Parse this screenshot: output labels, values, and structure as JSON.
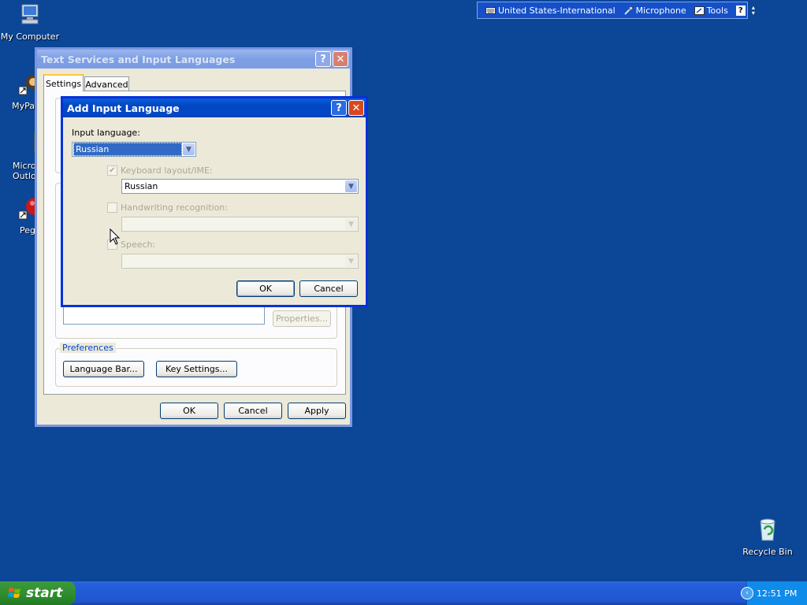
{
  "desktop": {
    "icons": [
      {
        "label": "My Computer"
      },
      {
        "label": "MyPa"
      },
      {
        "label": "Micros Outlo"
      },
      {
        "label": "Peg"
      },
      {
        "label": "Recycle Bin"
      }
    ]
  },
  "langbar": {
    "language": "United States-International",
    "microphone": "Microphone",
    "tools": "Tools"
  },
  "main_window": {
    "title": "Text Services and Input Languages",
    "tabs": [
      "Settings",
      "Advanced"
    ],
    "properties_button": "Properties...",
    "preferences_label": "Preferences",
    "language_bar_button": "Language Bar...",
    "key_settings_button": "Key Settings...",
    "ok": "OK",
    "cancel": "Cancel",
    "apply": "Apply"
  },
  "dialog": {
    "title": "Add Input Language",
    "input_language_label": "Input language:",
    "input_language_value": "Russian",
    "keyboard_label": "Keyboard layout/IME:",
    "keyboard_value": "Russian",
    "keyboard_checked": true,
    "handwriting_label": "Handwriting recognition:",
    "handwriting_checked": false,
    "speech_label": "Speech:",
    "speech_checked": false,
    "ok": "OK",
    "cancel": "Cancel"
  },
  "taskbar": {
    "start": "start",
    "clock": "12:51 PM"
  },
  "colors": {
    "desktop": "#0B4697",
    "title_active": "#0245C2",
    "selection": "#316AC5",
    "group_label": "#0046D5"
  }
}
